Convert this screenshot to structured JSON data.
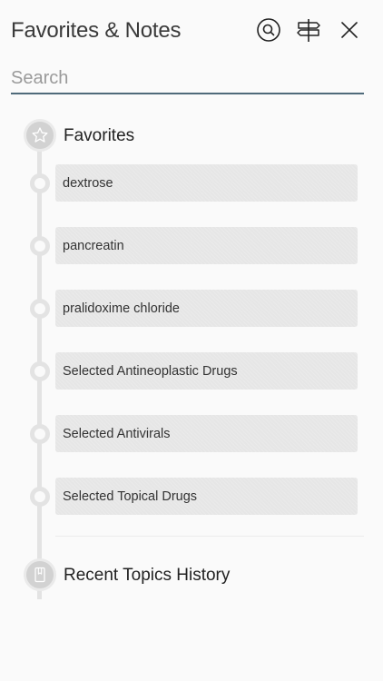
{
  "header": {
    "title": "Favorites & Notes"
  },
  "search": {
    "placeholder": "Search",
    "value": ""
  },
  "sections": {
    "favorites": {
      "label": "Favorites",
      "items": [
        {
          "label": "dextrose"
        },
        {
          "label": "pancreatin"
        },
        {
          "label": "pralidoxime chloride"
        },
        {
          "label": "Selected Antineoplastic Drugs"
        },
        {
          "label": "Selected Antivirals"
        },
        {
          "label": "Selected Topical Drugs"
        }
      ]
    },
    "recent": {
      "label": "Recent Topics History"
    }
  },
  "icons": {
    "header": [
      "search-icon",
      "signpost-icon",
      "close-icon"
    ],
    "favorites": "star-icon",
    "recent": "bookmark-icon"
  },
  "colors": {
    "search_underline": "#4f6a7a",
    "item_bg": "#e6e6e6",
    "timeline": "#e3e3e3"
  }
}
